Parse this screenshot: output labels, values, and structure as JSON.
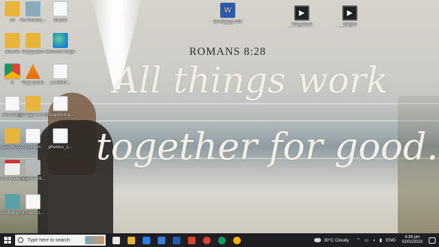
{
  "wallpaper": {
    "verse": "ROMANS 8:28",
    "line1": "All things work",
    "line2": "together for good."
  },
  "desktop_icons": [
    {
      "label": "a/l",
      "kind": "folder",
      "icon": "folder-icon"
    },
    {
      "label": "Ru-Wunisc...",
      "kind": "img-thumb",
      "icon": "image-file-icon"
    },
    {
      "label": "Sunilla",
      "kind": "doc",
      "icon": "document-icon"
    },
    {
      "label": "Zoowarng witn '000",
      "kind": "word",
      "icon": "word-document-icon"
    },
    {
      "label": "Vilagelona Samooi Var...",
      "kind": "video",
      "icon": "video-file-icon"
    },
    {
      "label": "Singiro Mihenivo ...",
      "kind": "video",
      "icon": "video-file-icon"
    },
    {
      "label": "almeria",
      "kind": "folder",
      "icon": "folder-icon"
    },
    {
      "label": "Graduation Videos",
      "kind": "folder",
      "icon": "folder-icon"
    },
    {
      "label": "Microsoft Edge",
      "kind": "edge",
      "icon": "edge-browser-icon"
    },
    {
      "label": "8",
      "kind": "chrome",
      "icon": "chrome-browser-icon"
    },
    {
      "label": "VLC media playe...",
      "kind": "vlc",
      "icon": "vlc-player-icon"
    },
    {
      "label": "Le-Illiiihl...",
      "kind": "doc",
      "icon": "document-icon"
    },
    {
      "label": "Henniebgi",
      "kind": "doc",
      "icon": "document-icon"
    },
    {
      "label": "GRADE 3 2H3 BA...",
      "kind": "folder",
      "icon": "folder-icon"
    },
    {
      "label": "Singleboing...",
      "kind": "doc",
      "icon": "document-icon"
    },
    {
      "label": "easyWAVe",
      "kind": "folder",
      "icon": "folder-icon"
    },
    {
      "label": "Hiddern",
      "kind": "doc",
      "icon": "document-icon"
    },
    {
      "label": "phonics_s...",
      "kind": "doc",
      "icon": "document-icon"
    },
    {
      "label": "school calendar",
      "kind": "cal",
      "icon": "calendar-file-icon"
    },
    {
      "label": "original-59...",
      "kind": "gray",
      "icon": "image-file-icon"
    },
    {
      "label": "mindfulness...",
      "kind": "teal",
      "icon": "image-file-icon"
    },
    {
      "label": "df748351...",
      "kind": "doc",
      "icon": "document-icon"
    }
  ],
  "taskbar": {
    "search_placeholder": "Type here to search",
    "apps": [
      {
        "name": "task-view",
        "color": "#e6e6e6"
      },
      {
        "name": "file-explorer",
        "color": "#e8b53a"
      },
      {
        "name": "mail",
        "color": "#2f7de1"
      },
      {
        "name": "store",
        "color": "#3b7dd8"
      },
      {
        "name": "word",
        "color": "#2b5bb0"
      },
      {
        "name": "powerpoint",
        "color": "#d24726"
      },
      {
        "name": "chrome",
        "color": "#db4437"
      },
      {
        "name": "chrome-2",
        "color": "#0f9d58"
      },
      {
        "name": "chrome-3",
        "color": "#f4b400"
      }
    ],
    "weather": "30°C  Cloudy",
    "language": "ENG",
    "time": "4:39 pm",
    "date": "02/02/2023"
  }
}
